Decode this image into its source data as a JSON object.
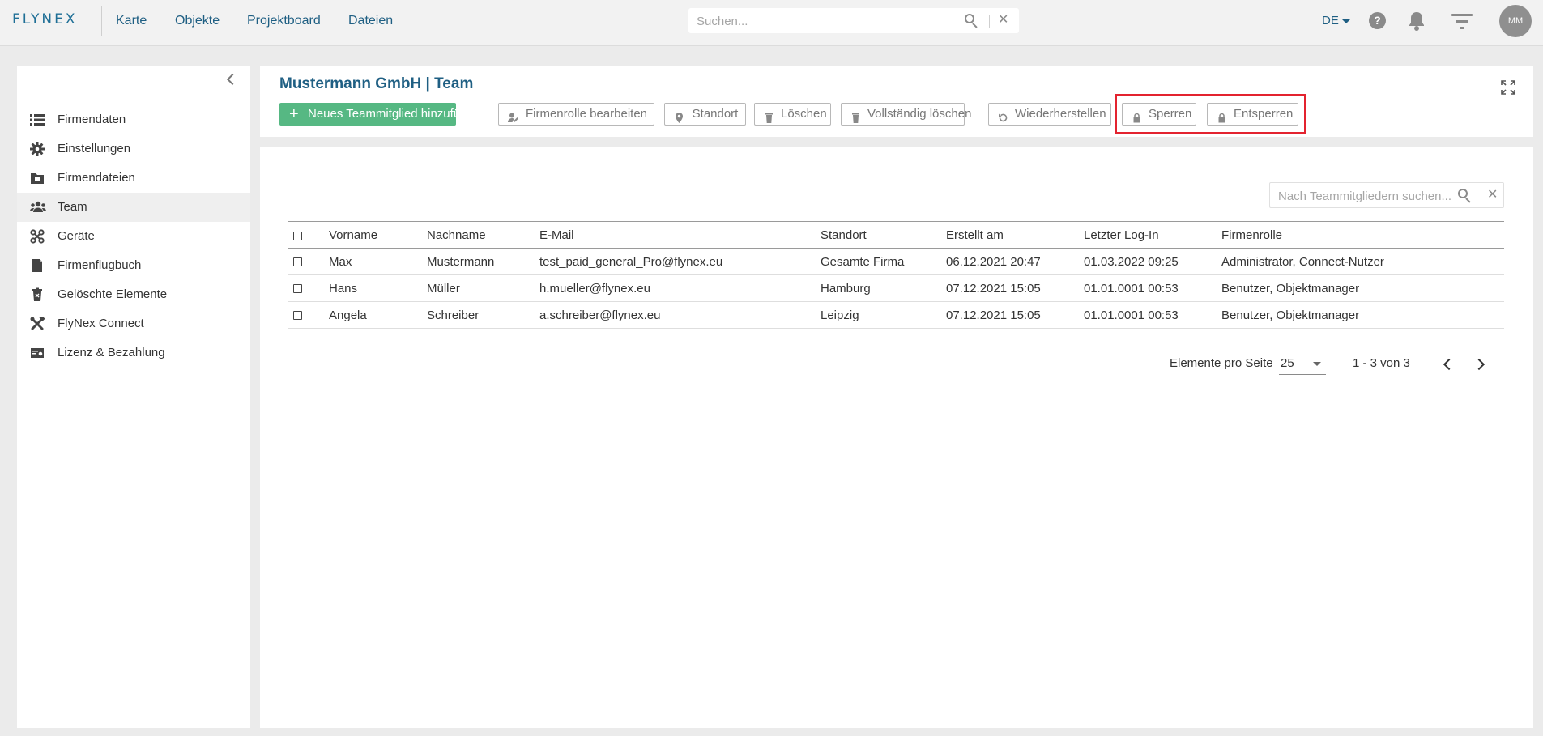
{
  "app": {
    "logo": "FLYNEX"
  },
  "topnav": {
    "links": [
      "Karte",
      "Objekte",
      "Projektboard",
      "Dateien"
    ],
    "search_placeholder": "Suchen...",
    "language": "DE",
    "help": "?",
    "avatar_initials": "MM"
  },
  "sidebar": {
    "items": [
      {
        "label": "Firmendaten",
        "icon": "list-icon"
      },
      {
        "label": "Einstellungen",
        "icon": "gear-icon"
      },
      {
        "label": "Firmendateien",
        "icon": "folder-icon"
      },
      {
        "label": "Team",
        "icon": "team-icon",
        "active": true
      },
      {
        "label": "Geräte",
        "icon": "drone-icon"
      },
      {
        "label": "Firmenflugbuch",
        "icon": "book-icon"
      },
      {
        "label": "Gelöschte Elemente",
        "icon": "trash-icon"
      },
      {
        "label": "FlyNex Connect",
        "icon": "tools-icon"
      },
      {
        "label": "Lizenz & Bezahlung",
        "icon": "license-icon"
      }
    ]
  },
  "header": {
    "title": "Mustermann GmbH | Team",
    "buttons": {
      "add": "Neues Teammitglied hinzufügen",
      "edit_role": "Firmenrolle bearbeiten",
      "location": "Standort",
      "delete": "Löschen",
      "delete_full": "Vollständig löschen",
      "restore": "Wiederherstellen",
      "lock": "Sperren",
      "unlock": "Entsperren"
    }
  },
  "team_search": {
    "placeholder": "Nach Teammitgliedern suchen..."
  },
  "table": {
    "columns": [
      "Vorname",
      "Nachname",
      "E-Mail",
      "Standort",
      "Erstellt am",
      "Letzter Log-In",
      "Firmenrolle"
    ],
    "rows": [
      [
        "Max",
        "Mustermann",
        "test_paid_general_Pro@flynex.eu",
        "Gesamte Firma",
        "06.12.2021 20:47",
        "01.03.2022 09:25",
        "Administrator, Connect-Nutzer"
      ],
      [
        "Hans",
        "Müller",
        "h.mueller@flynex.eu",
        "Hamburg",
        "07.12.2021 15:05",
        "01.01.0001 00:53",
        "Benutzer, Objektmanager"
      ],
      [
        "Angela",
        "Schreiber",
        "a.schreiber@flynex.eu",
        "Leipzig",
        "07.12.2021 15:05",
        "01.01.0001 00:53",
        "Benutzer, Objektmanager"
      ]
    ]
  },
  "pagination": {
    "label": "Elemente pro Seite",
    "page_size": "25",
    "range": "1 - 3 von 3"
  },
  "colors": {
    "brand": "#1f5f83",
    "primary_button": "#56b883",
    "highlight": "#e3232f"
  }
}
